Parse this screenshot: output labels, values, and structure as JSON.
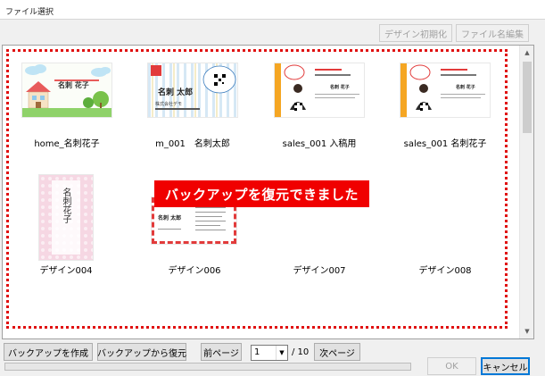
{
  "window": {
    "title": "ファイル選択"
  },
  "toolbar": {
    "reset_design_label": "デザイン初期化",
    "edit_filename_label": "ファイル名編集"
  },
  "thumbnails": [
    {
      "caption": "home_名刺花子",
      "name_text": "名刺 花子"
    },
    {
      "caption": "m_001　名刺太郎",
      "name_text": "名刺 太郎",
      "company_text": "株式会社デモ"
    },
    {
      "caption": "sales_001 入稿用",
      "name_text": "名刺 花子"
    },
    {
      "caption": "sales_001 名刺花子",
      "name_text": "名刺 花子"
    },
    {
      "caption": "デザイン004",
      "name_text": "名刺花子"
    },
    {
      "caption": "デザイン006",
      "name_text": "名刺 太郎"
    },
    {
      "caption": "デザイン007"
    },
    {
      "caption": "デザイン008"
    }
  ],
  "toast": {
    "message": "バックアップを復元できました"
  },
  "bottom": {
    "create_backup_label": "バックアップを作成",
    "restore_backup_label": "バックアップから復元",
    "prev_page_label": "前ページ",
    "page_value": "1",
    "page_total": "/ 10",
    "next_page_label": "次ページ",
    "ok_label": "OK",
    "cancel_label": "キャンセル"
  },
  "colors": {
    "toast_bg": "#f00000",
    "frame_dash": "#e01010",
    "primary_border": "#0078d7"
  },
  "progress": {
    "fraction": 0
  }
}
